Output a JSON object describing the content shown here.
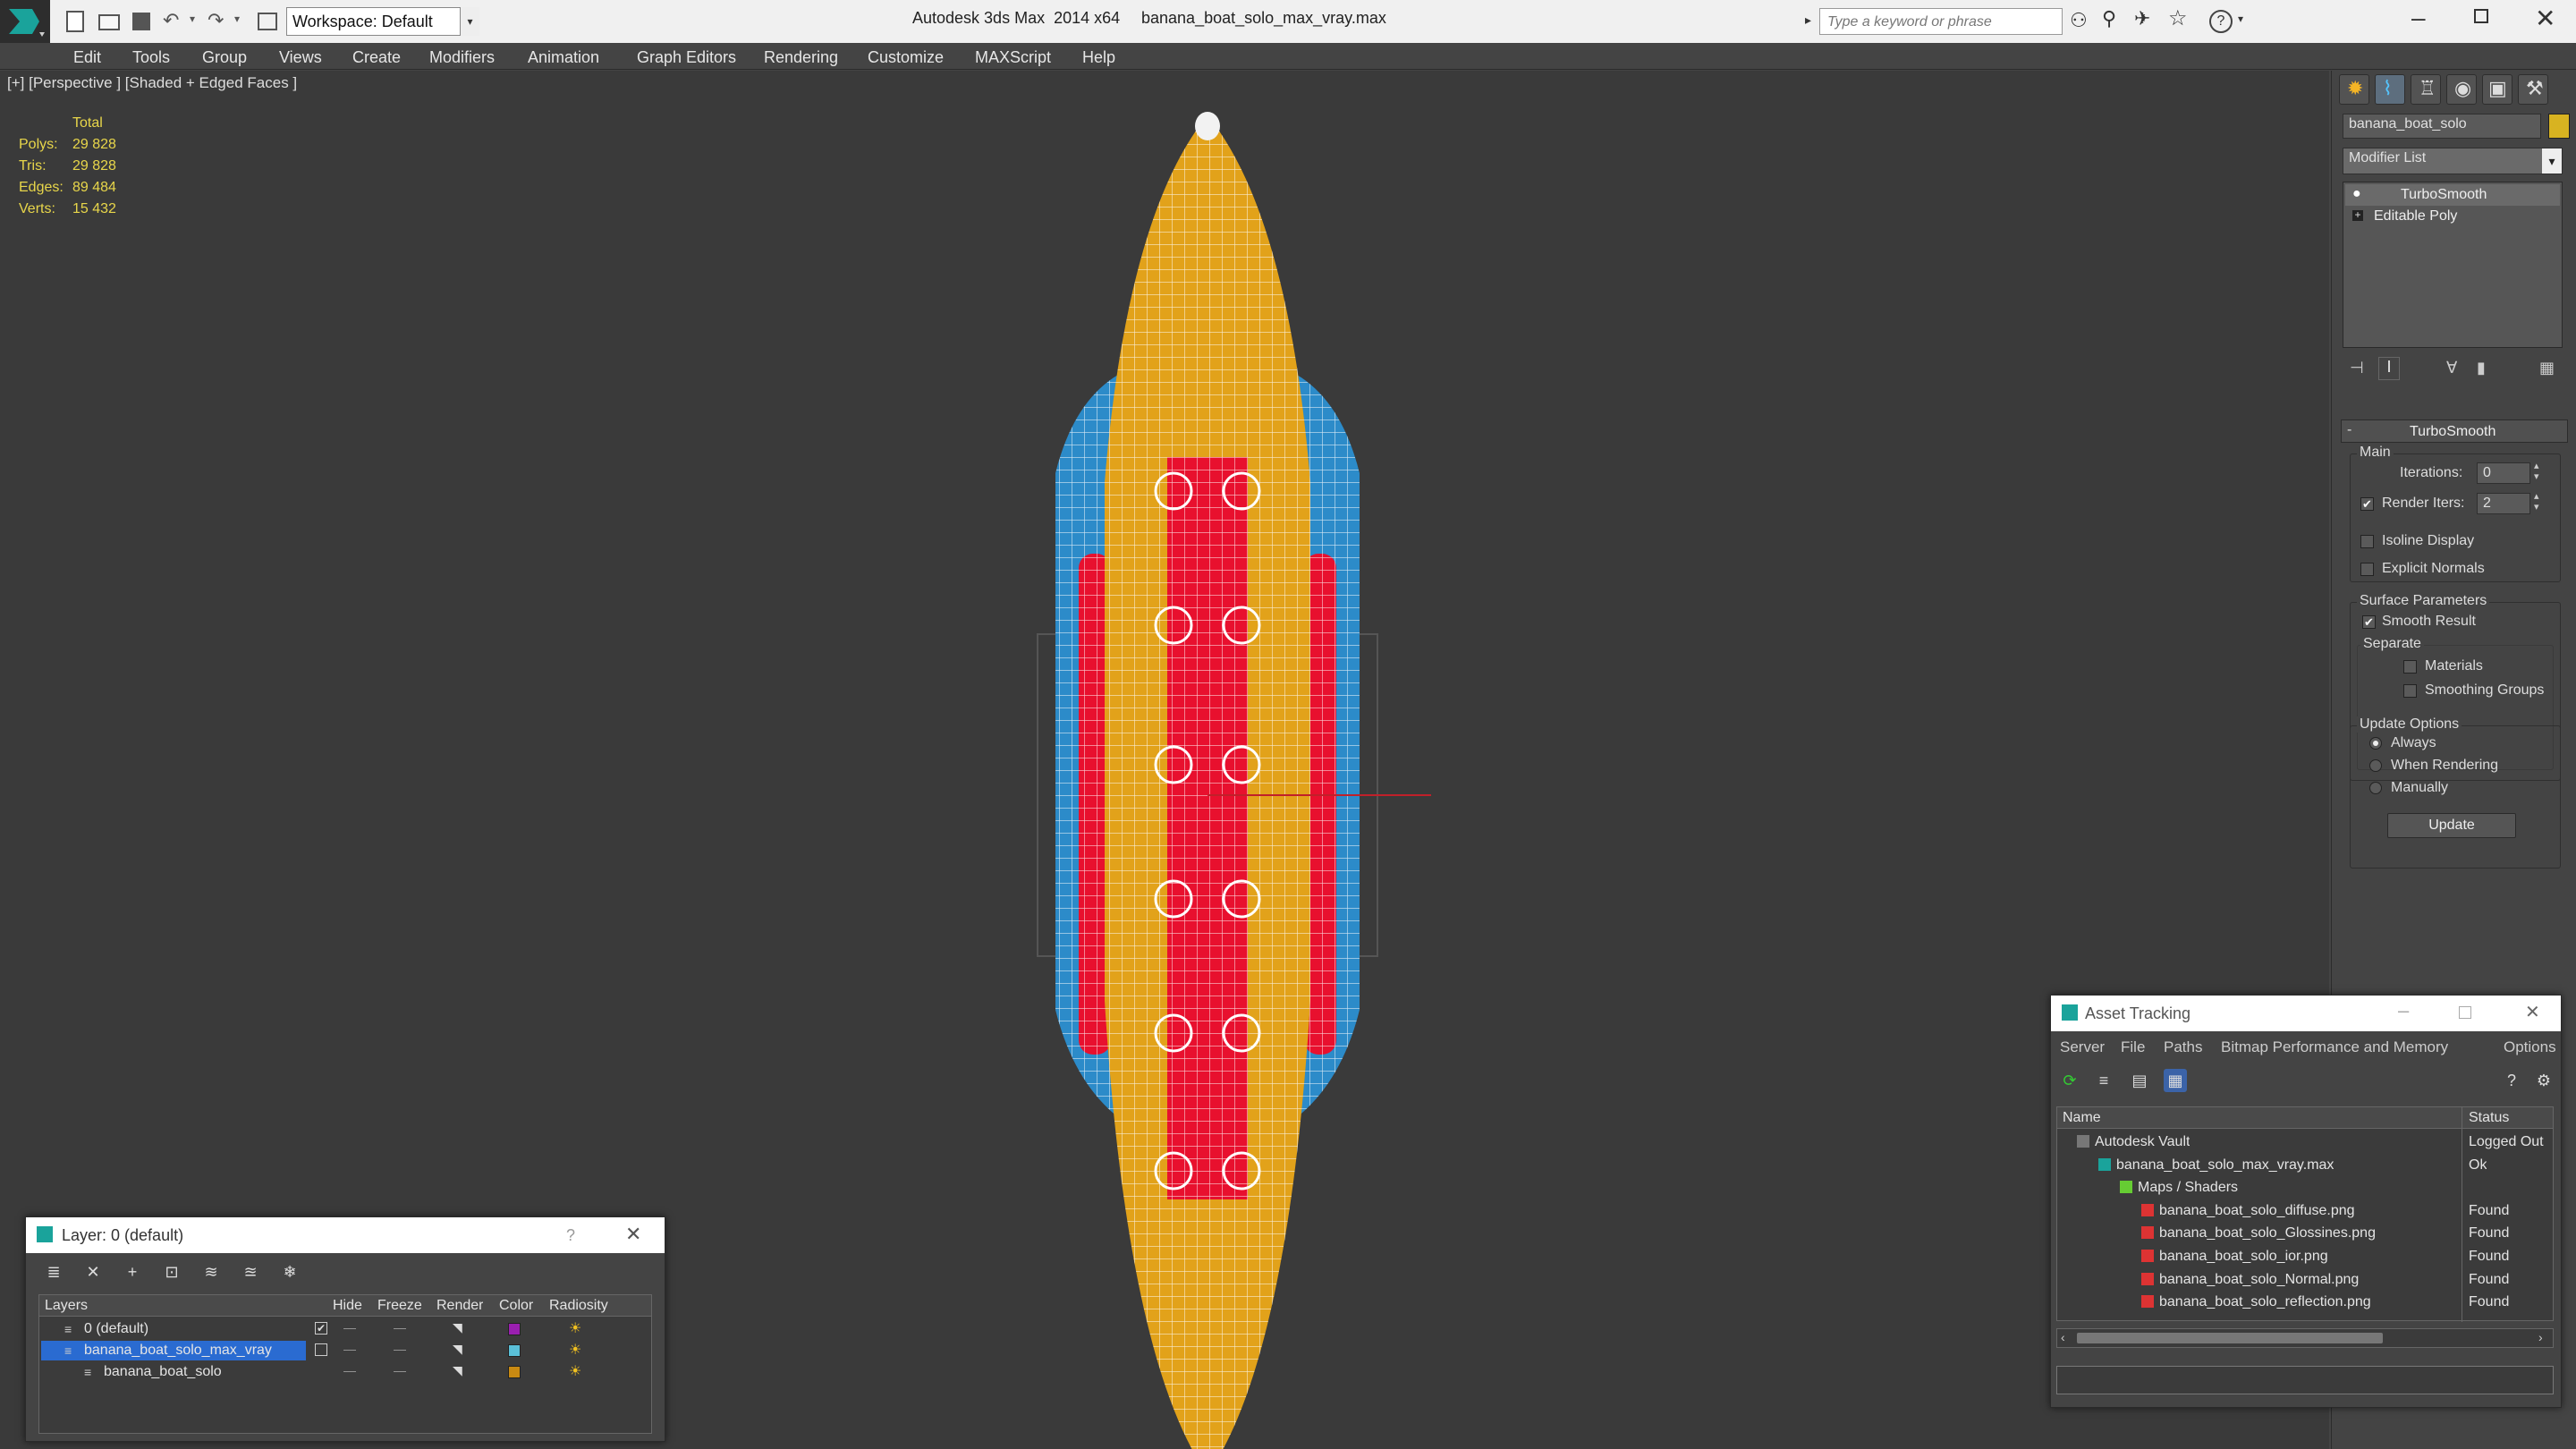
{
  "titlebar": {
    "workspace": "Workspace: Default",
    "app_title": "Autodesk 3ds Max  2014 x64",
    "file_title": "banana_boat_solo_max_vray.max",
    "search_placeholder": "Type a keyword or phrase",
    "help_icon": "?"
  },
  "menu": [
    "Edit",
    "Tools",
    "Group",
    "Views",
    "Create",
    "Modifiers",
    "Animation",
    "Graph Editors",
    "Rendering",
    "Customize",
    "MAXScript",
    "Help"
  ],
  "viewport": {
    "label": "[+] [Perspective ] [Shaded + Edged Faces ]",
    "stats_header": "Total",
    "stats": [
      {
        "k": "Polys:",
        "v": "29 828"
      },
      {
        "k": "Tris:",
        "v": "29 828"
      },
      {
        "k": "Edges:",
        "v": "89 484"
      },
      {
        "k": "Verts:",
        "v": "15 432"
      }
    ]
  },
  "command_panel": {
    "object_name": "banana_boat_solo",
    "object_color": "#d8b321",
    "modifier_list": "Modifier List",
    "stack": [
      "TurboSmooth",
      "Editable Poly"
    ],
    "rollout_title": "TurboSmooth",
    "main_label": "Main",
    "iterations_label": "Iterations:",
    "iterations_value": "0",
    "render_iters_label": "Render Iters:",
    "render_iters_value": "2",
    "render_iters_checked": true,
    "isoline_label": "Isoline Display",
    "explicit_normals_label": "Explicit Normals",
    "surface_params_label": "Surface Parameters",
    "smooth_result_label": "Smooth Result",
    "separate_label": "Separate",
    "materials_label": "Materials",
    "smoothing_groups_label": "Smoothing Groups",
    "update_options_label": "Update Options",
    "always_label": "Always",
    "when_rendering_label": "When Rendering",
    "manually_label": "Manually",
    "update_button": "Update"
  },
  "layer_dialog": {
    "title": "Layer: 0 (default)",
    "help": "?",
    "columns": [
      "Layers",
      "Hide",
      "Freeze",
      "Render",
      "Color",
      "Radiosity"
    ],
    "rows": [
      {
        "name": "0 (default)",
        "color": "#9a1fb0",
        "selected": false,
        "indent": 0
      },
      {
        "name": "banana_boat_solo_max_vray",
        "color": "#5ac0d8",
        "selected": true,
        "indent": 0
      },
      {
        "name": "banana_boat_solo",
        "color": "#c98a12",
        "selected": false,
        "indent": 1
      }
    ]
  },
  "asset_dialog": {
    "title": "Asset Tracking",
    "menu": [
      "Server",
      "File",
      "Paths",
      "Bitmap Performance and Memory",
      "Options"
    ],
    "columns": [
      "Name",
      "Status"
    ],
    "rows": [
      {
        "name": "Autodesk Vault",
        "status": "Logged Out",
        "indent": 0,
        "icon": "vault-icon"
      },
      {
        "name": "banana_boat_solo_max_vray.max",
        "status": "Ok",
        "indent": 1,
        "icon": "max-file-icon"
      },
      {
        "name": "Maps / Shaders",
        "status": "",
        "indent": 2,
        "icon": "maps-icon"
      },
      {
        "name": "banana_boat_solo_diffuse.png",
        "status": "Found",
        "indent": 3,
        "icon": "png-icon"
      },
      {
        "name": "banana_boat_solo_Glossines.png",
        "status": "Found",
        "indent": 3,
        "icon": "png-icon"
      },
      {
        "name": "banana_boat_solo_ior.png",
        "status": "Found",
        "indent": 3,
        "icon": "png-icon"
      },
      {
        "name": "banana_boat_solo_Normal.png",
        "status": "Found",
        "indent": 3,
        "icon": "png-icon"
      },
      {
        "name": "banana_boat_solo_reflection.png",
        "status": "Found",
        "indent": 3,
        "icon": "png-icon"
      }
    ]
  }
}
